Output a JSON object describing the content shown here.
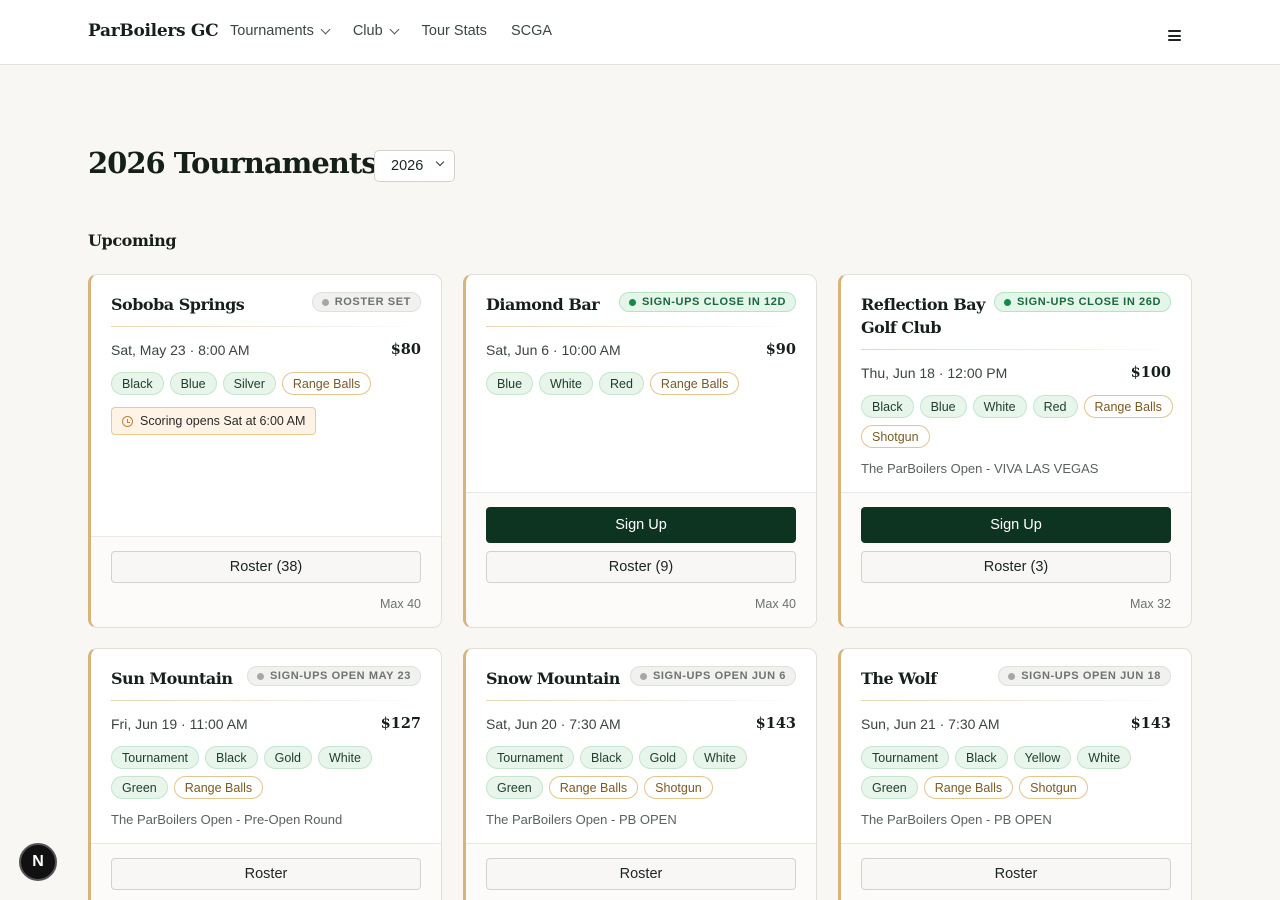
{
  "header": {
    "brand": "ParBoilers GC",
    "nav": [
      {
        "label": "Tournaments",
        "has_dropdown": true
      },
      {
        "label": "Club",
        "has_dropdown": true
      },
      {
        "label": "Tour Stats",
        "has_dropdown": false
      },
      {
        "label": "SCGA",
        "has_dropdown": false
      }
    ],
    "menu_icon": "hamburger-icon"
  },
  "page": {
    "title": "2026 Tournaments",
    "year_select": {
      "value": "2026"
    },
    "section": "Upcoming"
  },
  "colors": {
    "primary": "#0d3321",
    "accent_gold": "#d7b47a",
    "status_open": "#138a47",
    "status_neutral": "#a3a8a5"
  },
  "cards": [
    {
      "title": "Soboba Springs",
      "badge": "Roster Set",
      "date": "Sat, May 23 · 8:00 AM",
      "price": "$80",
      "tags": [
        "Black",
        "Blue",
        "Silver",
        "Range Balls"
      ],
      "note": "Scoring opens Sat at 6:00 AM",
      "roster": "Roster (38)",
      "max": "Max 40"
    },
    {
      "title": "Diamond Bar",
      "badge": "Sign-ups close in 12d",
      "date": "Sat, Jun 6 · 10:00 AM",
      "price": "$90",
      "tags": [
        "Blue",
        "White",
        "Red",
        "Range Balls"
      ],
      "signup": "Sign Up",
      "roster": "Roster (9)",
      "max": "Max 40"
    },
    {
      "title_line1": "Reflection Bay",
      "title_line2": "Golf Club",
      "badge": "Sign-ups close in 26d",
      "date": "Thu, Jun 18 · 12:00 PM",
      "price": "$100",
      "tags": [
        "Black",
        "Blue",
        "White",
        "Red",
        "Range Balls",
        "Shotgun"
      ],
      "event": "The ParBoilers Open - VIVA LAS VEGAS",
      "signup": "Sign Up",
      "roster": "Roster (3)",
      "max": "Max 32"
    },
    {
      "title": "Sun Mountain",
      "badge": "Sign-ups open May 23",
      "date": "Fri, Jun 19 · 11:00 AM",
      "price": "$127",
      "tags": [
        "Tournament",
        "Black",
        "Gold",
        "White",
        "Green",
        "Range Balls"
      ],
      "event": "The ParBoilers Open - Pre-Open Round",
      "roster": "Roster"
    },
    {
      "title": "Snow Mountain",
      "badge": "Sign-ups open Jun 6",
      "date": "Sat, Jun 20 · 7:30 AM",
      "price": "$143",
      "tags": [
        "Tournament",
        "Black",
        "Gold",
        "White",
        "Green",
        "Range Balls",
        "Shotgun"
      ],
      "event": "The ParBoilers Open - PB OPEN",
      "roster": "Roster"
    },
    {
      "title": "The Wolf",
      "badge": "Sign-ups open Jun 18",
      "date": "Sun, Jun 21 · 7:30 AM",
      "price": "$143",
      "tags": [
        "Tournament",
        "Black",
        "Yellow",
        "White",
        "Green",
        "Range Balls",
        "Shotgun"
      ],
      "event": "The ParBoilers Open - PB OPEN",
      "roster": "Roster"
    }
  ],
  "fab": {
    "label": "N"
  }
}
